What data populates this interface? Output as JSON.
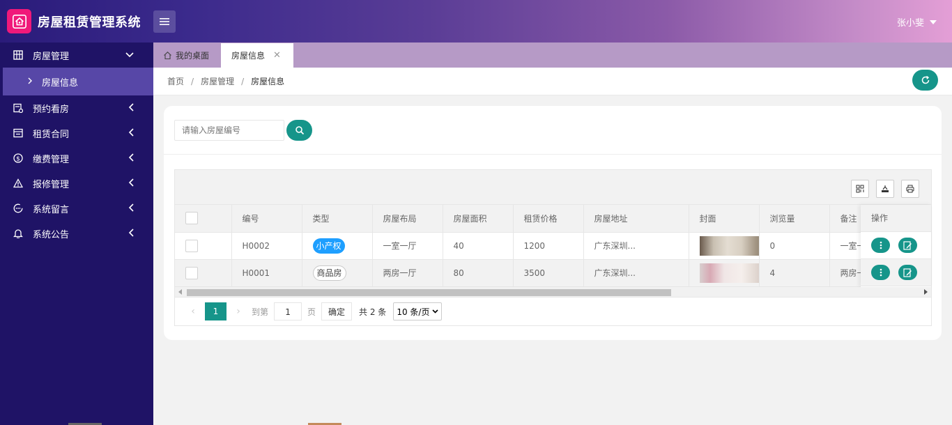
{
  "app": {
    "title": "房屋租赁管理系统",
    "user": "张小斐"
  },
  "sidebar": {
    "items": [
      {
        "label": "房屋管理",
        "icon": "building-icon",
        "expanded": true
      },
      {
        "label": "房屋信息",
        "icon": "chevron-right-icon",
        "sub": true,
        "active": true
      },
      {
        "label": "预约看房",
        "icon": "calendar-icon"
      },
      {
        "label": "租赁合同",
        "icon": "contract-icon"
      },
      {
        "label": "缴费管理",
        "icon": "dollar-icon"
      },
      {
        "label": "报修管理",
        "icon": "warning-icon"
      },
      {
        "label": "系统留言",
        "icon": "message-icon"
      },
      {
        "label": "系统公告",
        "icon": "bell-icon"
      }
    ]
  },
  "tabs": {
    "home": "我的桌面",
    "active": "房屋信息"
  },
  "breadcrumb": {
    "home": "首页",
    "parent": "房屋管理",
    "current": "房屋信息",
    "sep": "/"
  },
  "search": {
    "placeholder": "请输入房屋编号"
  },
  "table": {
    "headers": [
      "编号",
      "类型",
      "房屋布局",
      "房屋面积",
      "租赁价格",
      "房屋地址",
      "封面",
      "浏览量",
      "备注",
      "操作"
    ],
    "rows": [
      {
        "id": "H0002",
        "type": "小产权",
        "layout": "一室一厅",
        "area": "40",
        "price": "1200",
        "address": "广东深圳...",
        "views": "0",
        "note": "一室一"
      },
      {
        "id": "H0001",
        "type": "商品房",
        "layout": "两房一厅",
        "area": "80",
        "price": "3500",
        "address": "广东深圳...",
        "views": "4",
        "note": "两房一"
      }
    ]
  },
  "pager": {
    "prev": "‹",
    "next": "›",
    "current": "1",
    "goto_label": "到第",
    "page_value": "1",
    "page_label": "页",
    "confirm": "确定",
    "total": "共 2 条",
    "page_size": "10 条/页"
  },
  "colors": {
    "accent": "#16958a",
    "sidebar": "#1f1366",
    "tag_blue": "#1e9fff",
    "logo": "#f0197a"
  }
}
